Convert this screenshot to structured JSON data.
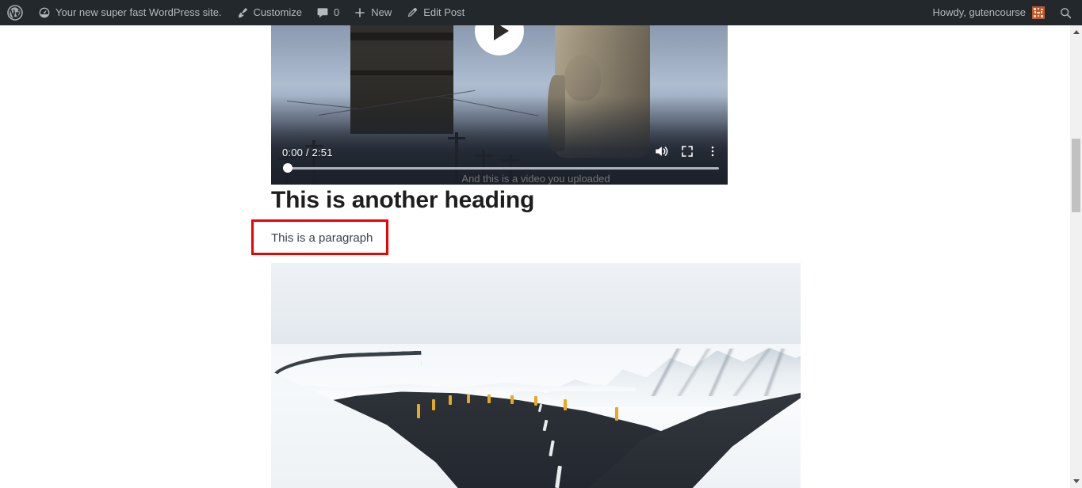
{
  "admin_bar": {
    "background_color": "#23282d",
    "text_color": "#b4b9be",
    "wp_logo_label": "W",
    "left_items": [
      {
        "icon": "wordpress-logo-icon",
        "label": ""
      },
      {
        "icon": "dashboard-icon",
        "label": "Your new super fast WordPress site."
      },
      {
        "icon": "paintbrush-icon",
        "label": "Customize"
      },
      {
        "icon": "comment-bubble-icon",
        "label": "0"
      },
      {
        "icon": "plus-icon",
        "label": "New"
      },
      {
        "icon": "pencil-icon",
        "label": "Edit Post"
      }
    ],
    "right": {
      "howdy_label": "Howdy, gutencourse",
      "avatar_icon": "user-avatar-identicon",
      "avatar_color": "#c0572a",
      "search_icon": "search-icon"
    }
  },
  "content": {
    "video": {
      "current_time": "0:00",
      "duration": "2:51",
      "time_display": "0:00 / 2:51",
      "play_icon": "play-button-icon",
      "volume_icon": "volume-icon",
      "fullscreen_icon": "fullscreen-icon",
      "more_options_icon": "kebab-menu-icon",
      "progress_percent": 0
    },
    "video_caption": "And this is a video you uploaded",
    "heading": "This is another heading",
    "paragraph": "This is a paragraph",
    "image_alt": "Snow covered winding road through icy landscape with yellow marker posts"
  },
  "annotation": {
    "highlight_color": "#ee0000",
    "target": "This is a paragraph"
  },
  "scrollbar": {
    "up_arrow_icon": "chevron-up-icon",
    "down_arrow_icon": "chevron-down-icon",
    "thumb_color": "#c1c1c1",
    "track_color": "#f1f1f1"
  }
}
